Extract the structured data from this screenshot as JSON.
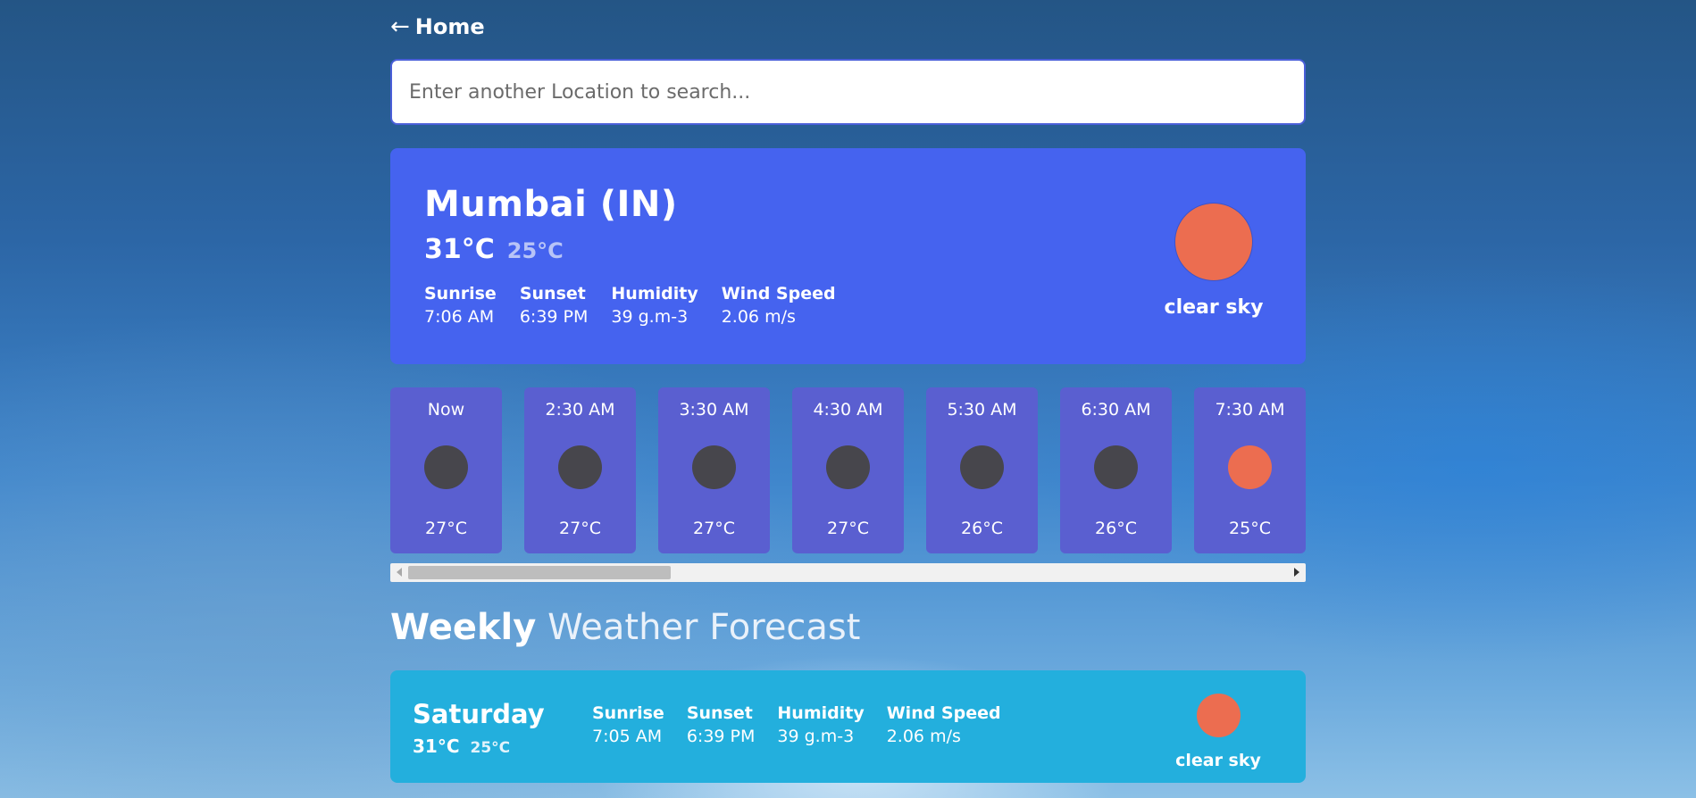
{
  "nav": {
    "arrow": "←",
    "home_label": "Home"
  },
  "search": {
    "placeholder": "Enter another Location to search..."
  },
  "current": {
    "city": "Mumbai (IN)",
    "temp_max": "31°C",
    "temp_min": "25°C",
    "stats": [
      {
        "label": "Sunrise",
        "value": "7:06 AM"
      },
      {
        "label": "Sunset",
        "value": "6:39 PM"
      },
      {
        "label": "Humidity",
        "value": "39 g.m-3"
      },
      {
        "label": "Wind Speed",
        "value": "2.06 m/s"
      }
    ],
    "icon": "sun-icon",
    "description": "clear sky"
  },
  "hourly": [
    {
      "time": "Now",
      "temp": "27°C",
      "icon": "moon-icon"
    },
    {
      "time": "2:30 AM",
      "temp": "27°C",
      "icon": "moon-icon"
    },
    {
      "time": "3:30 AM",
      "temp": "27°C",
      "icon": "moon-icon"
    },
    {
      "time": "4:30 AM",
      "temp": "27°C",
      "icon": "moon-icon"
    },
    {
      "time": "5:30 AM",
      "temp": "26°C",
      "icon": "moon-icon"
    },
    {
      "time": "6:30 AM",
      "temp": "26°C",
      "icon": "moon-icon"
    },
    {
      "time": "7:30 AM",
      "temp": "25°C",
      "icon": "sun-icon"
    }
  ],
  "weekly": {
    "title_bold": "Weekly",
    "title_rest": "Weather Forecast",
    "days": [
      {
        "day": "Saturday",
        "temp_max": "31°C",
        "temp_min": "25°C",
        "stats": [
          {
            "label": "Sunrise",
            "value": "7:05 AM"
          },
          {
            "label": "Sunset",
            "value": "6:39 PM"
          },
          {
            "label": "Humidity",
            "value": "39 g.m-3"
          },
          {
            "label": "Wind Speed",
            "value": "2.06 m/s"
          }
        ],
        "icon": "sun-icon",
        "description": "clear sky"
      }
    ]
  },
  "colors": {
    "sun": "#ec6d50",
    "moon": "#47464c",
    "current_card": "#4563ef",
    "hour_card": "#5a5fd0",
    "day_card": "#23afdd"
  }
}
